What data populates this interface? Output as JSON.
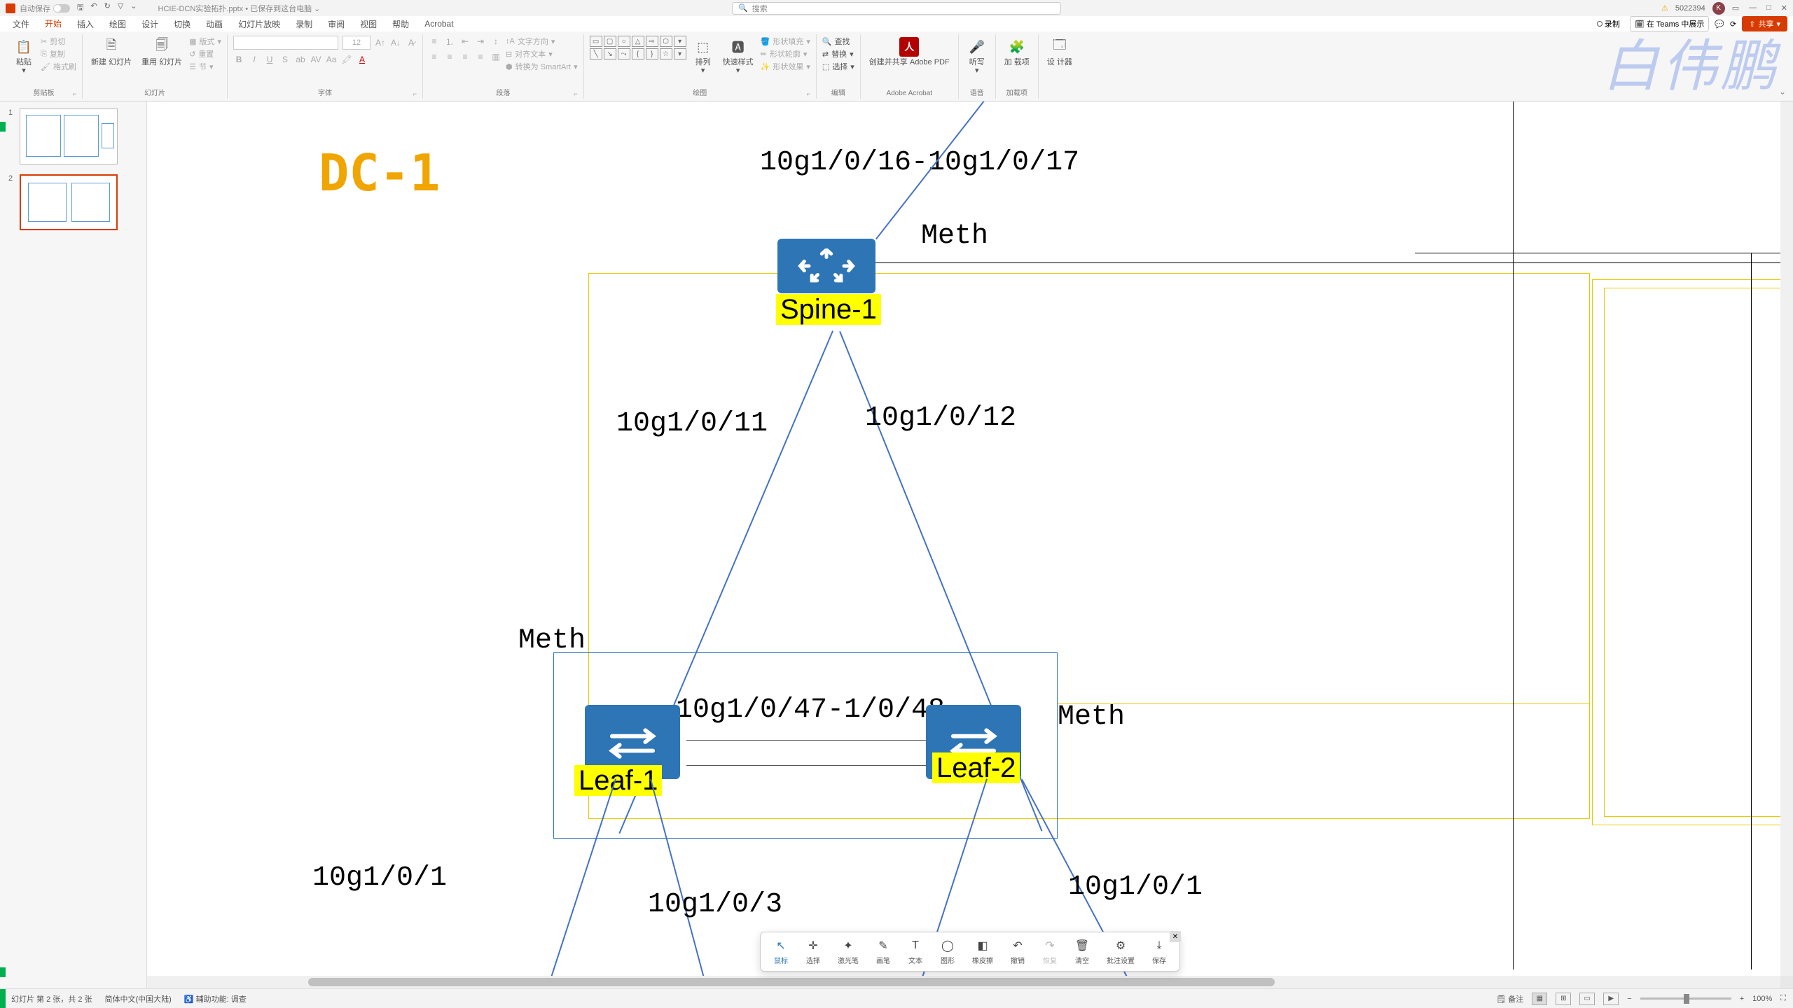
{
  "titlebar": {
    "autosave": "自动保存",
    "filename": "HCIE-DCN实验拓扑.pptx",
    "saved_hint": "• 已保存到这台电脑",
    "search_placeholder": "搜索",
    "account": "5022394",
    "avatar_initial": "K"
  },
  "menu": {
    "tabs": [
      "文件",
      "开始",
      "插入",
      "绘图",
      "设计",
      "切换",
      "动画",
      "幻灯片放映",
      "录制",
      "审阅",
      "视图",
      "帮助",
      "Acrobat"
    ],
    "active_index": 1,
    "record": "录制",
    "teams": "在 Teams 中展示",
    "share": "共享"
  },
  "ribbon": {
    "clipboard": {
      "paste": "粘贴",
      "cut": "剪切",
      "copy": "复制",
      "format_painter": "格式刷",
      "label": "剪贴板"
    },
    "slides": {
      "new": "新建\n幻灯片",
      "reuse": "重用\n幻灯片",
      "layout": "版式",
      "reset": "重置",
      "section": "节",
      "label": "幻灯片"
    },
    "font": {
      "size": "12",
      "label": "字体"
    },
    "paragraph": {
      "text_dir": "文字方向",
      "align_text": "对齐文本",
      "smartart": "转换为 SmartArt",
      "label": "段落"
    },
    "drawing": {
      "arrange": "排列",
      "quick_styles": "快速样式",
      "shape_fill": "形状填充",
      "shape_outline": "形状轮廓",
      "shape_effects": "形状效果",
      "label": "绘图"
    },
    "editing": {
      "find": "查找",
      "replace": "替换",
      "select": "选择",
      "label": "编辑"
    },
    "adobe": {
      "create_share": "创建并共享\nAdobe PDF",
      "label": "Adobe Acrobat"
    },
    "voice": {
      "dictate": "听写",
      "label": "语音"
    },
    "addins": {
      "addins": "加\n载项",
      "label": "加载项"
    },
    "designer": {
      "designer": "设\n计器",
      "label": ""
    }
  },
  "slide": {
    "dc_title": "DC-1",
    "spine1": "Spine-1",
    "leaf1": "Leaf-1",
    "leaf2": "Leaf-2",
    "meth_top": "Meth",
    "meth_left": "Meth",
    "meth_right": "Meth",
    "port_top": "10g1/0/16-10g1/0/17",
    "port_left_spine": "10g1/0/11",
    "port_right_spine": "10g1/0/12",
    "port_leaf_link": "10g1/0/47-1/0/48",
    "port_bottom_left": "10g1/0/1",
    "port_bottom_mid": "10g1/0/3",
    "port_bottom_right": "10g1/0/1"
  },
  "annobar": {
    "tools": [
      {
        "id": "cursor",
        "label": "鼠标",
        "icon": "↖"
      },
      {
        "id": "select",
        "label": "选择",
        "icon": "✛"
      },
      {
        "id": "laser",
        "label": "激光笔",
        "icon": "✦"
      },
      {
        "id": "pen",
        "label": "画笔",
        "icon": "✎"
      },
      {
        "id": "text",
        "label": "文本",
        "icon": "T"
      },
      {
        "id": "shape",
        "label": "图形",
        "icon": "◯"
      },
      {
        "id": "eraser",
        "label": "橡皮擦",
        "icon": "◧"
      },
      {
        "id": "undo",
        "label": "撤销",
        "icon": "↶"
      },
      {
        "id": "redo",
        "label": "恢复",
        "icon": "↷"
      },
      {
        "id": "clear",
        "label": "清空",
        "icon": "🗑"
      },
      {
        "id": "settings",
        "label": "批注设置",
        "icon": "⚙"
      },
      {
        "id": "save",
        "label": "保存",
        "icon": "⤓"
      }
    ],
    "active": 0,
    "disabled": [
      8
    ]
  },
  "status": {
    "slide_info": "幻灯片 第 2 张，共 2 张",
    "lang": "简体中文(中国大陆)",
    "access": "辅助功能: 调查",
    "notes": "备注",
    "zoom": "100%"
  },
  "watermark": "白伟鹏"
}
